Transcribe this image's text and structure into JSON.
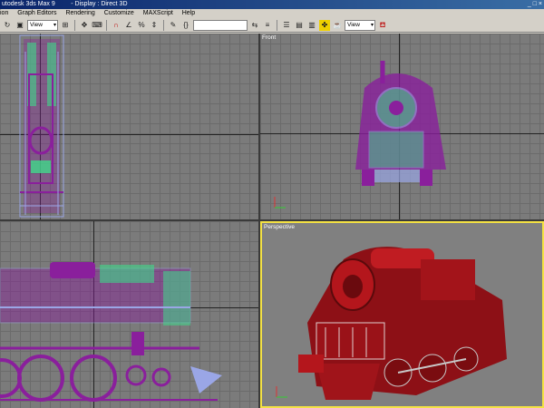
{
  "window": {
    "title": "utodesk 3ds Max 9         - Display : Direct 3D",
    "controls": "_ □ ×"
  },
  "menu": [
    "ion",
    "Graph Editors",
    "Rendering",
    "Customize",
    "MAXScript",
    "Help"
  ],
  "toolbar": {
    "view_select_1": "View",
    "view_select_2": "View"
  },
  "viewports": {
    "top_left": {
      "label": ""
    },
    "front": {
      "label": "Front"
    },
    "left": {
      "label": ""
    },
    "perspective": {
      "label": "Perspective"
    }
  },
  "colors": {
    "wire_purple": "#8a1f9c",
    "wire_green": "#3fd98a",
    "wire_blue": "#9aa6e6",
    "viewport_bg": "#7b7b7b",
    "active_border": "#f4e244",
    "render_red": "#b4161c"
  }
}
